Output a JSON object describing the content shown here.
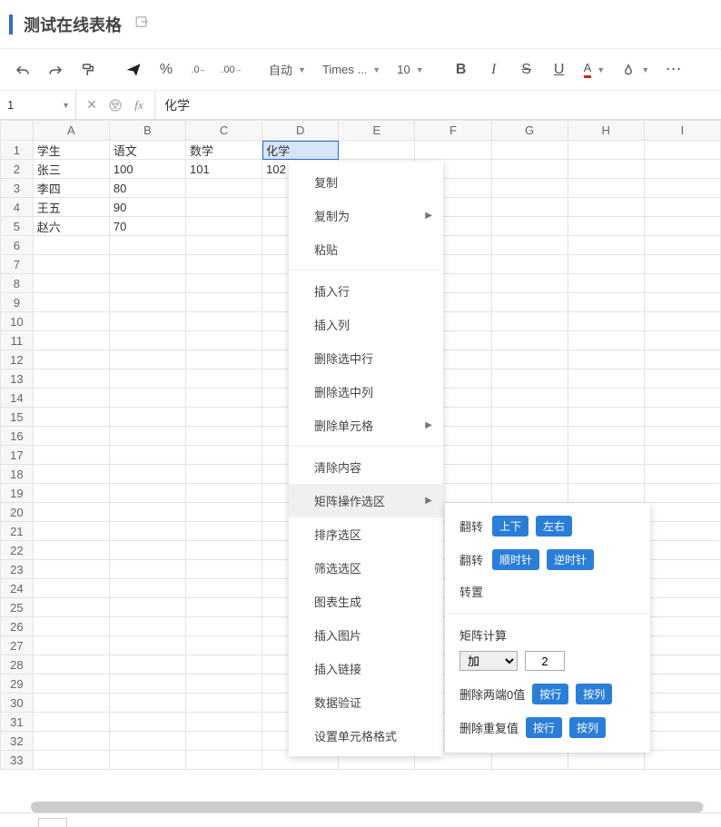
{
  "title": "测试在线表格",
  "toolbar": {
    "auto_label": "自动",
    "font_label": "Times ...",
    "font_size": "10"
  },
  "formula": {
    "cellref": "1",
    "value": "化学"
  },
  "columns": [
    "A",
    "B",
    "C",
    "D",
    "E",
    "F",
    "G",
    "H",
    "I"
  ],
  "rows_count": 33,
  "data": {
    "r1": {
      "A": "学生",
      "B": "语文",
      "C": "数学",
      "D": "化学"
    },
    "r2": {
      "A": "张三",
      "B": "100",
      "C": "101",
      "D": "102"
    },
    "r3": {
      "A": "李四",
      "B": "80"
    },
    "r4": {
      "A": "王五",
      "B": "90"
    },
    "r5": {
      "A": "赵六",
      "B": "70"
    }
  },
  "selected_cell": "D1",
  "ctx": {
    "copy": "复制",
    "copy_as": "复制为",
    "paste": "粘贴",
    "insert_row": "插入行",
    "insert_col": "插入列",
    "del_sel_row": "删除选中行",
    "del_sel_col": "删除选中列",
    "del_cell": "删除单元格",
    "clear": "清除内容",
    "matrix_sel": "矩阵操作选区",
    "sort_sel": "排序选区",
    "filter_sel": "筛选选区",
    "chart_gen": "图表生成",
    "insert_img": "插入图片",
    "insert_link": "插入链接",
    "data_valid": "数据验证",
    "cell_format": "设置单元格格式"
  },
  "sub": {
    "flip_label": "翻转",
    "flip_ud": "上下",
    "flip_lr": "左右",
    "rotate_label": "翻转",
    "rotate_cw": "顺时针",
    "rotate_ccw": "逆时针",
    "transpose": "转置",
    "matrix_calc": "矩阵计算",
    "op_selected": "加",
    "op_value": "2",
    "trim_zero": "删除两端0值",
    "by_row": "按行",
    "by_col": "按列",
    "del_dup": "删除重复值"
  }
}
